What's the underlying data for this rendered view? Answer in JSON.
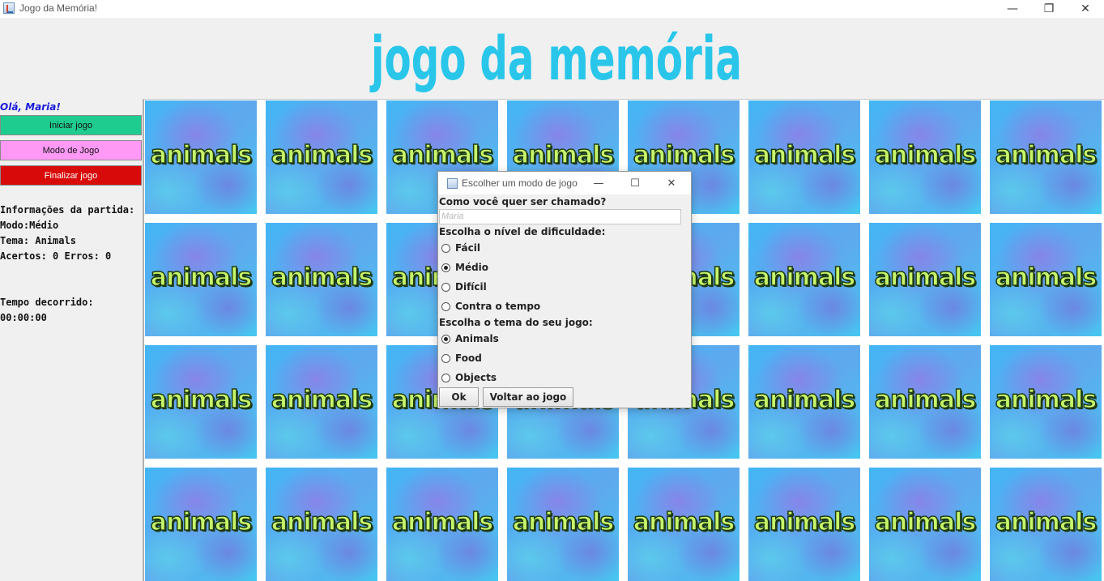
{
  "window": {
    "title": "Jogo da Memória!",
    "controls": {
      "minimize": "—",
      "maximize": "❐",
      "close": "✕"
    }
  },
  "header": {
    "logo_text": "jogo da memória",
    "logo_color": "#29c6ea"
  },
  "sidebar": {
    "greeting": "Olá, Maria!",
    "buttons": {
      "start": "Iniciar jogo",
      "mode": "Modo de Jogo",
      "finish": "Finalizar jogo"
    },
    "info": {
      "heading": "Informações da partida:",
      "mode": "Modo:Médio",
      "theme": "Tema: Animals",
      "score": "Acertos: 0 Erros: 0",
      "time_label": "Tempo decorrido:",
      "time_value": "00:00:00"
    }
  },
  "board": {
    "card_label": "animals"
  },
  "dialog": {
    "title": "Escolher um modo de jogo",
    "name_question": "Como você quer ser chamado?",
    "name_value": "Maria",
    "difficulty_question": "Escolha o nível de dificuldade:",
    "difficulty_options": [
      "Fácil",
      "Médio",
      "Difícil",
      "Contra o tempo"
    ],
    "difficulty_selected": "Médio",
    "theme_question": "Escolha o tema do seu jogo:",
    "theme_options": [
      "Animals",
      "Food",
      "Objects"
    ],
    "theme_selected": "Animals",
    "ok_label": "Ok",
    "back_label": "Voltar ao jogo"
  }
}
